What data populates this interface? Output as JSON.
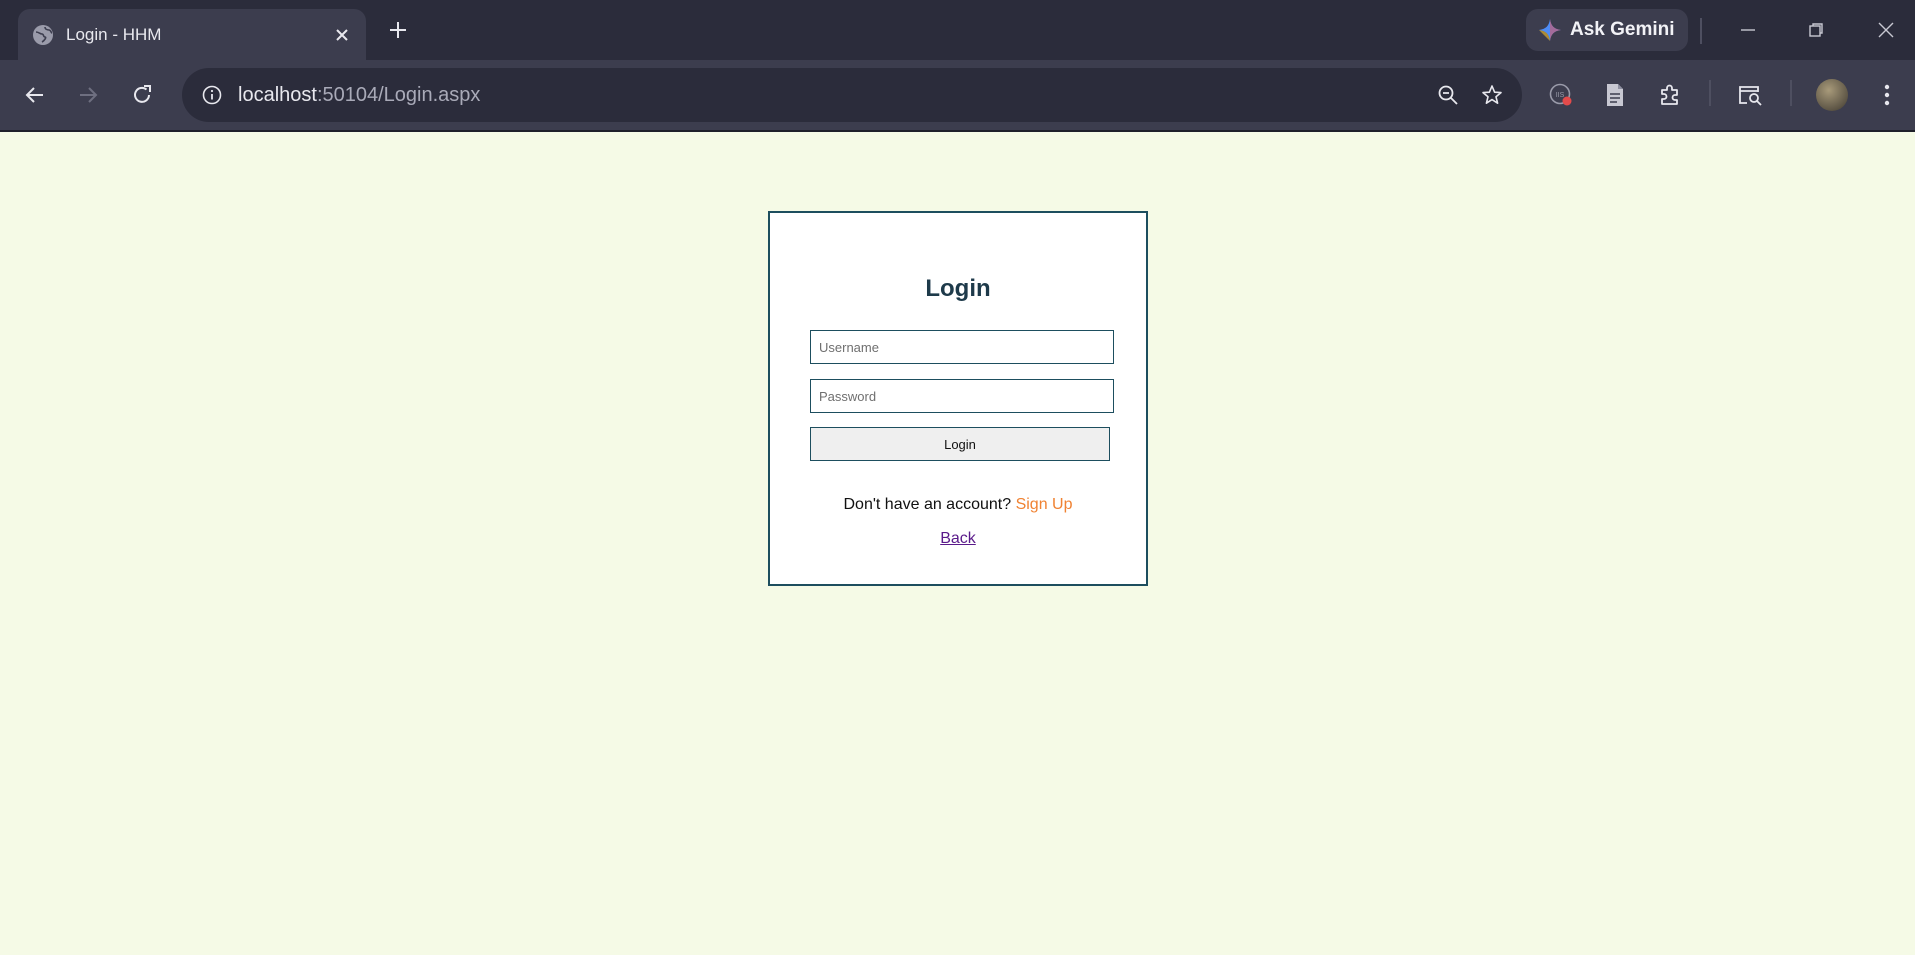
{
  "browser": {
    "tab": {
      "title": "Login - HHM"
    },
    "gemini": {
      "label": "Ask Gemini"
    },
    "address": {
      "host": "localhost",
      "path": ":50104/Login.aspx"
    },
    "icons": [
      "globe-icon",
      "close-icon",
      "plus-icon",
      "gemini-star-icon",
      "minimize-icon",
      "restore-icon",
      "window-close-icon",
      "back-arrow-icon",
      "forward-arrow-icon",
      "reload-icon",
      "info-icon",
      "zoom-out-icon",
      "bookmark-star-icon",
      "extension-badge-icon",
      "document-icon",
      "puzzle-icon",
      "tab-search-icon",
      "avatar",
      "kebab-menu-icon"
    ]
  },
  "login": {
    "title": "Login",
    "username_placeholder": "Username",
    "password_placeholder": "Password",
    "button_label": "Login",
    "signup_prompt": "Don't have an account?",
    "signup_link": "Sign Up",
    "back_link": "Back"
  },
  "colors": {
    "page_background": "#F5FAE6",
    "box_border": "#1D4E5E",
    "title_color": "#1E3A4A",
    "signup_link": "#F08232",
    "back_link": "#5A1A8A"
  }
}
